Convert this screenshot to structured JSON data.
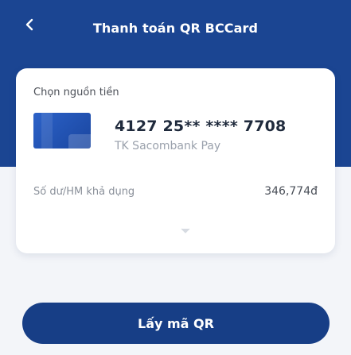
{
  "header": {
    "title": "Thanh toán QR BCCard",
    "back_icon": "chevron-left-icon",
    "background_color": "#1b4592"
  },
  "payment_source": {
    "label": "Chọn nguồn tiền",
    "card_number": "4127 25** **** 7708",
    "account_name": "TK Sacombank Pay",
    "balance_label": "Số dư/HM khả dụng",
    "balance_value": "346,774đ",
    "expand_icon": "chevron-down-icon"
  },
  "actions": {
    "primary_label": "Lấy mã QR",
    "primary_color": "#173e86"
  }
}
